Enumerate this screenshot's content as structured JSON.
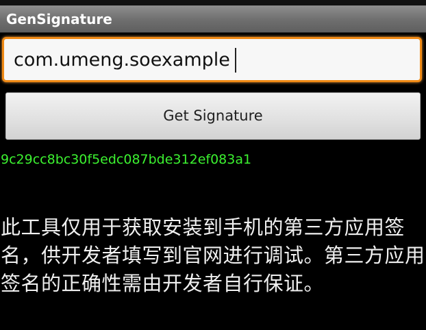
{
  "app": {
    "title": "GenSignature"
  },
  "form": {
    "package_input_value": "com.umeng.soexample",
    "button_label": "Get Signature"
  },
  "result": {
    "signature": "9c29cc8bc30f5edc087bde312ef083a1"
  },
  "info": {
    "description": "此工具仅用于获取安装到手机的第三方应用签名，供开发者填写到官网进行调试。第三方应用签名的正确性需由开发者自行保证。"
  },
  "colors": {
    "input_focus_border": "#f08a15",
    "signature_text": "#3cf230",
    "background": "#000000"
  }
}
